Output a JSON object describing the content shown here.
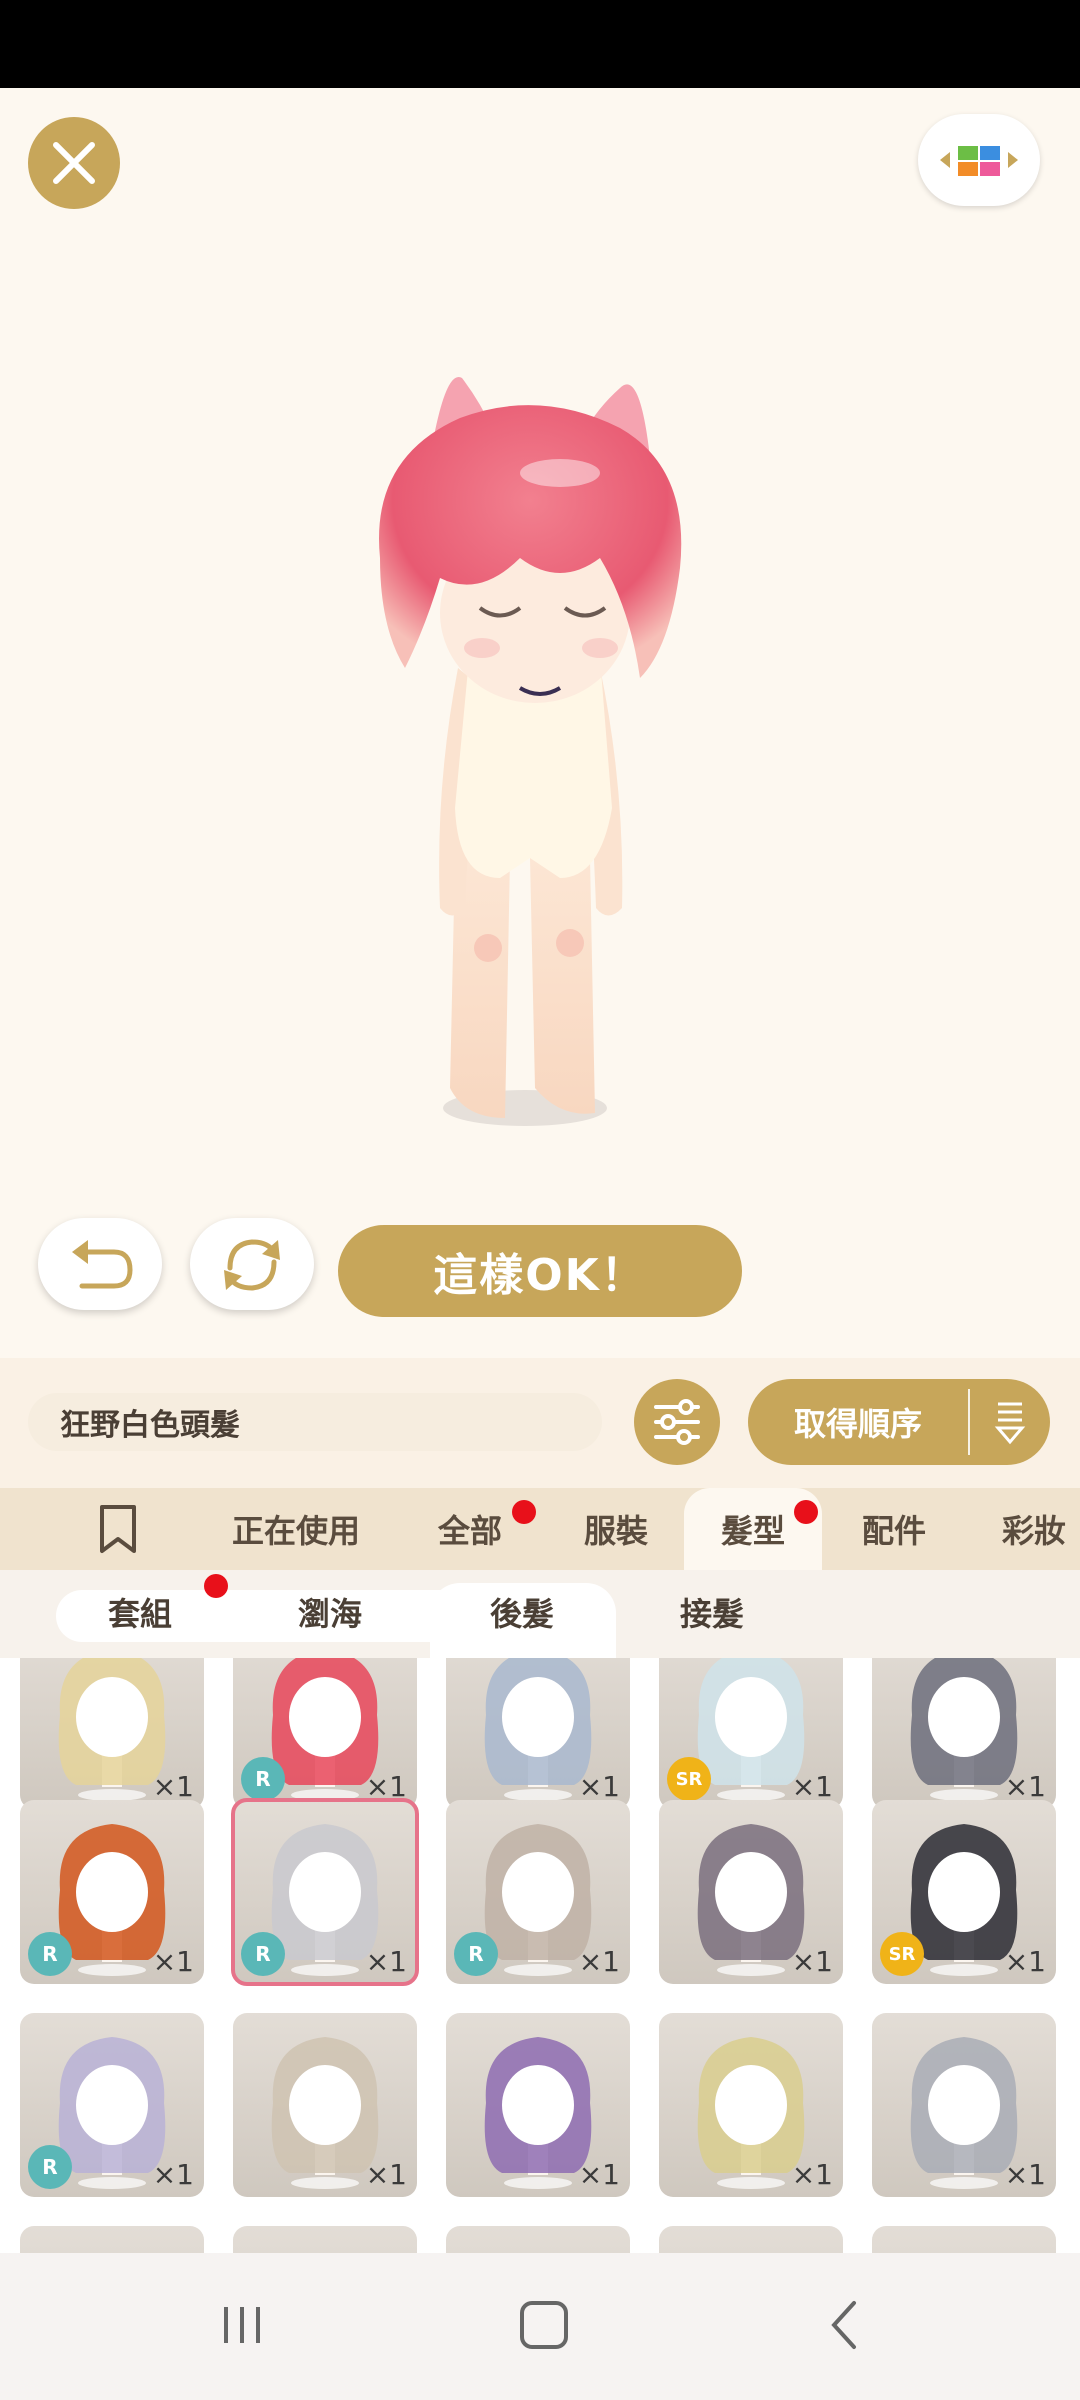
{
  "action_buttons": {
    "ok_label": "這樣OK！"
  },
  "info_bar": {
    "item_name": "狂野白色頭髮",
    "order_label": "取得順序"
  },
  "category_tabs": [
    {
      "label": "正在使用",
      "has_dot": false,
      "active": false
    },
    {
      "label": "全部",
      "has_dot": true,
      "active": false
    },
    {
      "label": "服裝",
      "has_dot": false,
      "active": false
    },
    {
      "label": "髮型",
      "has_dot": true,
      "active": true
    },
    {
      "label": "配件",
      "has_dot": false,
      "active": false
    },
    {
      "label": "彩妝",
      "has_dot": false,
      "active": false
    }
  ],
  "sub_tabs": [
    {
      "label": "套組",
      "has_dot": true,
      "active": false
    },
    {
      "label": "瀏海",
      "has_dot": false,
      "active": false
    },
    {
      "label": "後髮",
      "has_dot": false,
      "active": true
    },
    {
      "label": "接髮",
      "has_dot": false,
      "active": false
    }
  ],
  "items": {
    "row1": [
      {
        "count": "×1",
        "rarity": "",
        "hair": "#E5D39A"
      },
      {
        "count": "×1",
        "rarity": "R",
        "hair": "#E8475B"
      },
      {
        "count": "×1",
        "rarity": "",
        "hair": "#A9B9CF"
      },
      {
        "count": "×1",
        "rarity": "SR",
        "hair": "#CFE3EA"
      },
      {
        "count": "×1",
        "rarity": "",
        "hair": "#6D6F7D"
      }
    ],
    "row2": [
      {
        "count": "×1",
        "rarity": "R",
        "hair": "#D2561C"
      },
      {
        "count": "×1",
        "rarity": "R",
        "hair": "#C9C9CF"
      },
      {
        "count": "×1",
        "rarity": "R",
        "hair": "#BFB2A6"
      },
      {
        "count": "×1",
        "rarity": "",
        "hair": "#7A6F7E"
      },
      {
        "count": "×1",
        "rarity": "SR",
        "hair": "#2C2C34"
      }
    ],
    "row3": [
      {
        "count": "×1",
        "rarity": "R",
        "hair": "#B9B2D6"
      },
      {
        "count": "×1",
        "rarity": "",
        "hair": "#CFC3B2"
      },
      {
        "count": "×1",
        "rarity": "",
        "hair": "#8E6CB2"
      },
      {
        "count": "×1",
        "rarity": "",
        "hair": "#D9CE8E"
      },
      {
        "count": "×1",
        "rarity": "",
        "hair": "#A9ADB6"
      }
    ]
  },
  "colors": {
    "accent": "#C7A65A",
    "notification": "#E8101A",
    "selected_border": "#E6738A",
    "rarity_r": "#5AB7B7",
    "rarity_sr": "#F0B318"
  },
  "icons": [
    "close-icon",
    "palette-icon",
    "undo-icon",
    "refresh-icon",
    "filter-sliders-icon",
    "sort-icon",
    "bookmark-icon",
    "recent-apps-icon",
    "home-icon",
    "back-icon"
  ]
}
